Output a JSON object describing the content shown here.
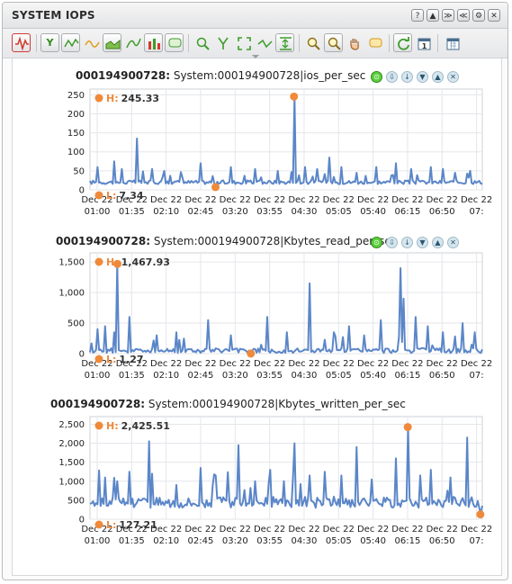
{
  "window": {
    "title": "SYSTEM IOPS",
    "buttons": [
      "?",
      "▲",
      "≫",
      "≪",
      "⚙",
      "✕"
    ]
  },
  "toolbar": {
    "icons": [
      "waveform-icon",
      "y-axis-icon",
      "line-style-icon",
      "curve-icon",
      "area-icon",
      "spline-icon",
      "bar-icon",
      "comment-icon",
      "zoom-x-icon",
      "zoom-y-icon",
      "fit-icon",
      "smooth-icon",
      "scale-icon",
      "zoom-in-icon",
      "zoom-select-icon",
      "pan-icon",
      "note-icon",
      "refresh-icon",
      "calendar-icon",
      "calendar-grid-icon"
    ]
  },
  "colors": {
    "line": "#5b86c8",
    "marker": "#ef8a3b",
    "grid": "#e4e6ea"
  },
  "chart_data": [
    {
      "type": "line",
      "entity": "000194900728:",
      "metric": "System:000194900728|ios_per_sec",
      "high_label": "H:",
      "high_value": "245.33",
      "low_label": "L:",
      "low_value": "7.34",
      "yticks": [
        "0",
        "50",
        "100",
        "150",
        "200",
        "250"
      ],
      "ylim": [
        0,
        265
      ],
      "xticks": [
        [
          "Dec 22",
          "01:00"
        ],
        [
          "Dec 22",
          "01:35"
        ],
        [
          "Dec 22",
          "02:10"
        ],
        [
          "Dec 22",
          "02:45"
        ],
        [
          "Dec 22",
          "03:20"
        ],
        [
          "Dec 22",
          "03:55"
        ],
        [
          "Dec 22",
          "04:30"
        ],
        [
          "Dec 22",
          "05:05"
        ],
        [
          "Dec 22",
          "05:40"
        ],
        [
          "Dec 22",
          "06:15"
        ],
        [
          "Dec 22",
          "06:50"
        ],
        [
          "Dec 22",
          "07:"
        ]
      ],
      "baseline": 20,
      "noise": 5,
      "spikes": [
        [
          0.02,
          60
        ],
        [
          0.06,
          75
        ],
        [
          0.08,
          55
        ],
        [
          0.12,
          135
        ],
        [
          0.16,
          55
        ],
        [
          0.19,
          50
        ],
        [
          0.28,
          70
        ],
        [
          0.36,
          60
        ],
        [
          0.42,
          55
        ],
        [
          0.48,
          50
        ],
        [
          0.55,
          60
        ],
        [
          0.58,
          55
        ],
        [
          0.61,
          85
        ],
        [
          0.64,
          60
        ],
        [
          0.68,
          45
        ],
        [
          0.73,
          60
        ],
        [
          0.78,
          70
        ],
        [
          0.82,
          55
        ],
        [
          0.87,
          60
        ],
        [
          0.9,
          55
        ],
        [
          0.93,
          45
        ],
        [
          0.97,
          50
        ]
      ],
      "high_point": [
        0.52,
        245.33
      ],
      "low_point": [
        0.32,
        7.34
      ]
    },
    {
      "type": "line",
      "entity": "000194900728:",
      "metric": "System:000194900728|Kbytes_read_per_sec",
      "high_label": "H:",
      "high_value": "1,467.93",
      "low_label": "L:",
      "low_value": "1.27",
      "yticks": [
        "0",
        "500",
        "1,000",
        "1,500"
      ],
      "ylim": [
        0,
        1650
      ],
      "xticks": [
        [
          "Dec 22",
          "01:00"
        ],
        [
          "Dec 22",
          "01:35"
        ],
        [
          "Dec 22",
          "02:10"
        ],
        [
          "Dec 22",
          "02:45"
        ],
        [
          "Dec 22",
          "03:20"
        ],
        [
          "Dec 22",
          "03:55"
        ],
        [
          "Dec 22",
          "04:30"
        ],
        [
          "Dec 22",
          "05:05"
        ],
        [
          "Dec 22",
          "05:40"
        ],
        [
          "Dec 22",
          "06:15"
        ],
        [
          "Dec 22",
          "06:50"
        ],
        [
          "Dec 22",
          "07:"
        ]
      ],
      "baseline": 50,
      "noise": 40,
      "spikes": [
        [
          0.02,
          400
        ],
        [
          0.04,
          450
        ],
        [
          0.06,
          350
        ],
        [
          0.1,
          600
        ],
        [
          0.17,
          300
        ],
        [
          0.22,
          350
        ],
        [
          0.3,
          550
        ],
        [
          0.36,
          300
        ],
        [
          0.45,
          600
        ],
        [
          0.5,
          350
        ],
        [
          0.56,
          1150
        ],
        [
          0.62,
          350
        ],
        [
          0.66,
          450
        ],
        [
          0.7,
          300
        ],
        [
          0.74,
          550
        ],
        [
          0.79,
          1400
        ],
        [
          0.8,
          900
        ],
        [
          0.83,
          600
        ],
        [
          0.86,
          450
        ],
        [
          0.9,
          350
        ],
        [
          0.95,
          500
        ],
        [
          0.98,
          350
        ]
      ],
      "high_point": [
        0.07,
        1467.93
      ],
      "low_point": [
        0.41,
        1.27
      ]
    },
    {
      "type": "line",
      "entity": "000194900728:",
      "metric": "System:000194900728|Kbytes_written_per_sec",
      "high_label": "H:",
      "high_value": "2,425.51",
      "low_label": "L:",
      "low_value": "127.21",
      "yticks": [
        "0",
        "500",
        "1,000",
        "1,500",
        "2,000",
        "2,500"
      ],
      "ylim": [
        0,
        2700
      ],
      "xticks": [
        [
          "Dec 22",
          "01:00"
        ],
        [
          "Dec 22",
          "01:35"
        ],
        [
          "Dec 22",
          "02:10"
        ],
        [
          "Dec 22",
          "02:45"
        ],
        [
          "Dec 22",
          "03:20"
        ],
        [
          "Dec 22",
          "03:55"
        ],
        [
          "Dec 22",
          "04:30"
        ],
        [
          "Dec 22",
          "05:05"
        ],
        [
          "Dec 22",
          "05:40"
        ],
        [
          "Dec 22",
          "06:15"
        ],
        [
          "Dec 22",
          "06:50"
        ],
        [
          "Dec 22",
          "07:"
        ]
      ],
      "baseline": 450,
      "noise": 150,
      "spikes": [
        [
          0.04,
          1100
        ],
        [
          0.07,
          1000
        ],
        [
          0.1,
          1250
        ],
        [
          0.15,
          2050
        ],
        [
          0.22,
          900
        ],
        [
          0.28,
          1350
        ],
        [
          0.32,
          1150
        ],
        [
          0.38,
          1950
        ],
        [
          0.42,
          1000
        ],
        [
          0.46,
          1300
        ],
        [
          0.52,
          2000
        ],
        [
          0.56,
          1150
        ],
        [
          0.6,
          1250
        ],
        [
          0.64,
          1150
        ],
        [
          0.68,
          1900
        ],
        [
          0.72,
          1050
        ],
        [
          0.78,
          1600
        ],
        [
          0.84,
          1150
        ],
        [
          0.87,
          1300
        ],
        [
          0.92,
          1100
        ],
        [
          0.96,
          2150
        ]
      ],
      "high_point": [
        0.81,
        2425.51
      ],
      "low_point": [
        0.995,
        127.21
      ]
    }
  ]
}
